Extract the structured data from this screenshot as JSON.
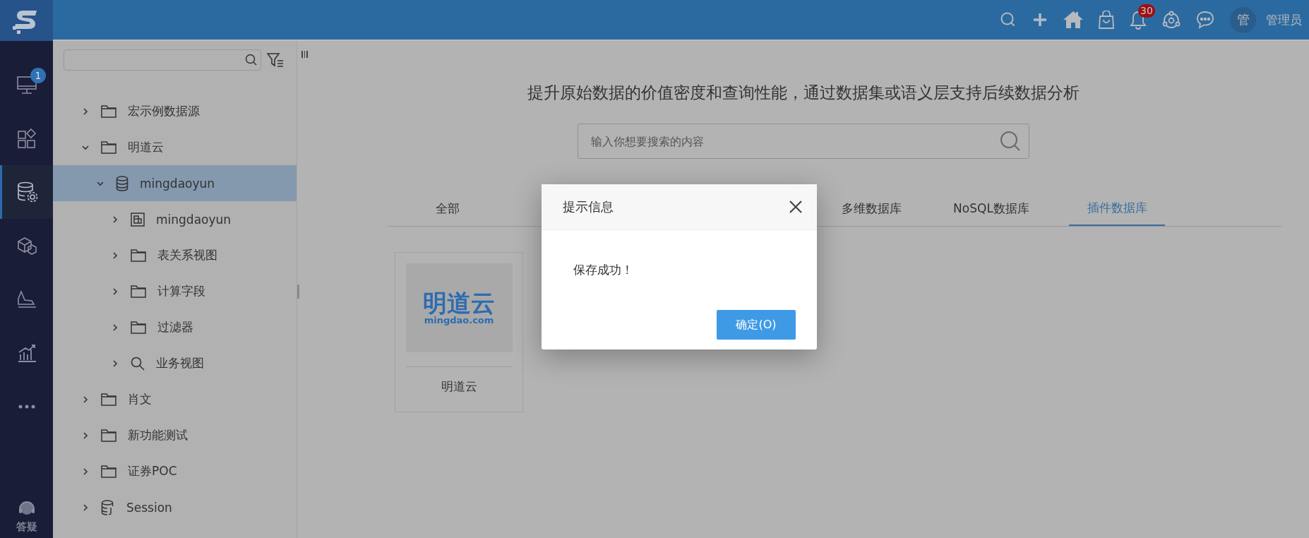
{
  "top_bar": {
    "notifications_badge": "30",
    "avatar": "管",
    "user_name": "管理员"
  },
  "rail": {
    "items": [
      {
        "kind": "monitor",
        "badge": "1",
        "selected": false
      },
      {
        "kind": "apps",
        "selected": false
      },
      {
        "kind": "database",
        "selected": true
      },
      {
        "kind": "cubes",
        "selected": false
      },
      {
        "kind": "ramp",
        "selected": false
      },
      {
        "kind": "chart",
        "selected": false
      },
      {
        "kind": "more",
        "selected": false
      }
    ],
    "help_label": "答疑"
  },
  "tree": {
    "items": [
      {
        "label": "宏示例数据源",
        "kind": "folder",
        "expanded": false,
        "selected": false
      },
      {
        "label": "明道云",
        "kind": "folder",
        "expanded": true,
        "selected": false,
        "children": [
          {
            "label": "mingdaoyun",
            "kind": "database",
            "expanded": true,
            "selected": true,
            "children": [
              {
                "label": "mingdaoyun",
                "kind": "table",
                "expanded": false,
                "selected": false
              },
              {
                "label": "表关系视图",
                "kind": "folder",
                "expanded": false,
                "selected": false
              },
              {
                "label": "计算字段",
                "kind": "folder",
                "expanded": false,
                "selected": false
              },
              {
                "label": "过滤器",
                "kind": "folder",
                "expanded": false,
                "selected": false
              },
              {
                "label": "业务视图",
                "kind": "search",
                "expanded": false,
                "selected": false
              }
            ]
          }
        ]
      },
      {
        "label": "肖文",
        "kind": "folder",
        "expanded": false,
        "selected": false
      },
      {
        "label": "新功能测试",
        "kind": "folder",
        "expanded": false,
        "selected": false
      },
      {
        "label": "证券POC",
        "kind": "folder",
        "expanded": false,
        "selected": false
      },
      {
        "label": "Session",
        "kind": "dbfile",
        "expanded": false,
        "selected": false
      }
    ]
  },
  "main": {
    "headline": "提升原始数据的价值密度和查询性能，通过数据集或语义层支持后续数据分析",
    "search": {
      "placeholder": "输入你想要搜索的内容"
    },
    "tabs": [
      {
        "label": "全部",
        "selected": false
      },
      {
        "label": "多维数据库",
        "selected": false
      },
      {
        "label": "NoSQL数据库",
        "selected": false
      },
      {
        "label": "插件数据库",
        "selected": true
      }
    ],
    "cards": [
      {
        "logo_name": "明道云",
        "logo_domain": "mingdao.com",
        "label": "明道云"
      }
    ]
  },
  "dialog": {
    "title": "提示信息",
    "message": "保存成功！",
    "button": "确定(O)"
  }
}
